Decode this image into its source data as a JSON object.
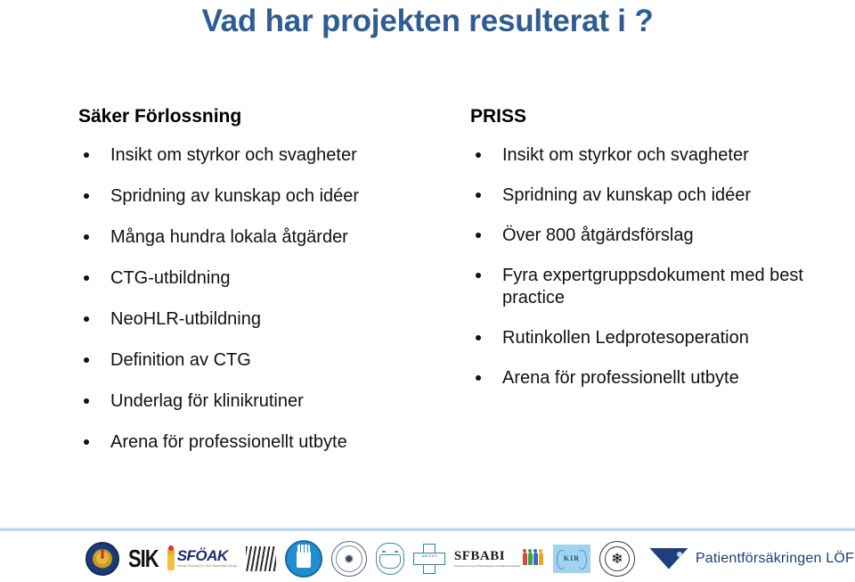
{
  "slide": {
    "title": "Vad har projekten resulterat i ?",
    "title_color": "#2f5c93"
  },
  "columns": {
    "left": {
      "heading": "Säker Förlossning",
      "bullets": [
        "Insikt om styrkor och svagheter",
        "Spridning av kunskap och idéer",
        "Många hundra lokala åtgärder",
        "CTG-utbildning",
        "NeoHLR-utbildning",
        "Definition av CTG",
        "Underlag för klinikrutiner",
        "Arena för professionellt utbyte"
      ]
    },
    "right": {
      "heading": "PRISS",
      "bullets": [
        "Insikt om styrkor och svagheter",
        "Spridning av kunskap och idéer",
        "Över 800 åtgärdsförslag",
        "Fyra expertgruppsdokument med best practice",
        "Rutinkollen Ledprotesoperation",
        "Arena för professionellt utbyte"
      ]
    }
  },
  "footer": {
    "divider_color": "#aacbe8",
    "logos": [
      {
        "name": "svenska-lakaresallskapet-seal",
        "kind": "seal-gold",
        "label": ""
      },
      {
        "name": "sik-wordmark",
        "kind": "sik",
        "label": "SIK"
      },
      {
        "name": "sfoak-logo",
        "kind": "sfoak",
        "label": "SFÖAK",
        "sub": "Svensk Förening för Övre Abdominell Kirurgi"
      },
      {
        "name": "striped-logo",
        "kind": "striped",
        "label": ""
      },
      {
        "name": "blue-hand-circle-logo",
        "kind": "hand",
        "label": ""
      },
      {
        "name": "circular-seal-logo",
        "kind": "seal-line",
        "label": ""
      },
      {
        "name": "masked-face-logo",
        "kind": "mask",
        "label": ""
      },
      {
        "name": "medical-cross-logo",
        "kind": "cross",
        "label": "ANESTESI OCH INTENSIVVÅRD"
      },
      {
        "name": "sfbabi-logo",
        "kind": "sfbabi",
        "label": "SFBABI",
        "sub": "Svensk Förening för Barnanestesi och Barnintensivvård"
      },
      {
        "name": "kir-logo",
        "kind": "kir",
        "label": "KIR"
      },
      {
        "name": "fish-seal-logo",
        "kind": "seal-fish",
        "label": ""
      },
      {
        "name": "patientforsakringen-lof-logo",
        "kind": "lof",
        "label": "Patientförsäkringen LÖF"
      }
    ],
    "lof_text": "Patientförsäkringen LÖF",
    "sfoak_text": "SFÖAK",
    "sfoak_sub": "Svensk Förening för Övre Abdominell Kirurgi",
    "sik_text": "SIK",
    "sfbabi_text": "SFBABI",
    "sfbabi_sub": "Svensk Förening för Barnanestesi och Barnintensivvård",
    "kir_text": "KIR",
    "cross_text": "ANESTESI"
  }
}
